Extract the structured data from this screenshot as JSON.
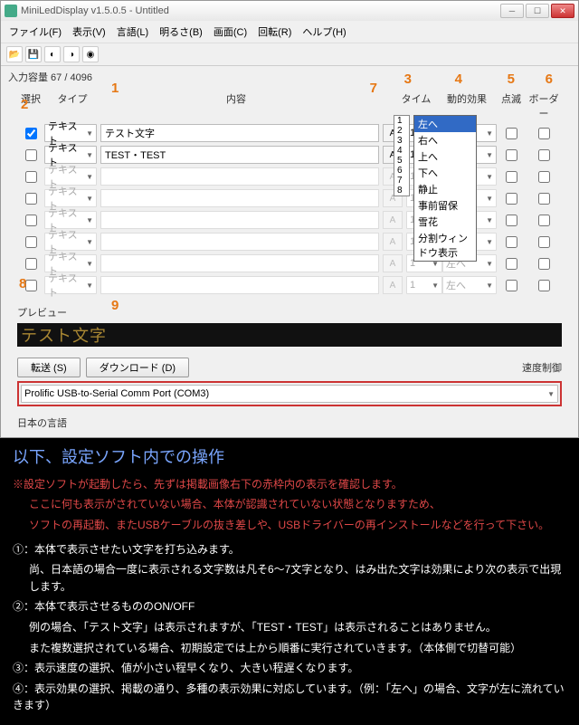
{
  "window": {
    "title": "MiniLedDisplay v1.5.0.5 - Untitled"
  },
  "menu": [
    "ファイル(F)",
    "表示(V)",
    "言語(L)",
    "明るさ(B)",
    "画面(C)",
    "回転(R)",
    "ヘルプ(H)"
  ],
  "capacity": "入力容量 67 / 4096",
  "hdr": {
    "sel": "選択",
    "type": "タイプ",
    "content": "内容",
    "time": "タイム",
    "eff": "動的効果",
    "flash": "点滅",
    "border": "ボーダー"
  },
  "type_label": "テキスト",
  "rows": [
    {
      "checked": true,
      "content": "テスト文字",
      "a": "A",
      "time": "1",
      "eff": "左へ"
    },
    {
      "checked": false,
      "content": "TEST・TEST",
      "a": "A",
      "time": "1",
      "eff": "左へ"
    },
    {
      "checked": false,
      "content": "",
      "a": "A",
      "time": "1",
      "eff": "左へ"
    },
    {
      "checked": false,
      "content": "",
      "a": "A",
      "time": "1",
      "eff": "左へ"
    },
    {
      "checked": false,
      "content": "",
      "a": "A",
      "time": "1",
      "eff": "左へ"
    },
    {
      "checked": false,
      "content": "",
      "a": "A",
      "time": "1",
      "eff": "左へ"
    },
    {
      "checked": false,
      "content": "",
      "a": "A",
      "time": "1",
      "eff": "左へ"
    },
    {
      "checked": false,
      "content": "",
      "a": "A",
      "time": "1",
      "eff": "左へ"
    }
  ],
  "time_opts": [
    "1",
    "2",
    "3",
    "4",
    "5",
    "6",
    "7",
    "8"
  ],
  "eff_opts": [
    "左へ",
    "右へ",
    "上へ",
    "下へ",
    "静止",
    "事前留保",
    "雪花",
    "分割ウィンドウ表示"
  ],
  "preview_label": "プレビュー",
  "preview_text": "テスト文字",
  "btn_send": "転送 (S)",
  "btn_dl": "ダウンロード (D)",
  "speed_label": "速度制御",
  "port": "Prolific USB-to-Serial Comm Port (COM3)",
  "lang": "日本の言語",
  "annot": {
    "1": "1",
    "2": "2",
    "3": "3",
    "4": "4",
    "5": "5",
    "6": "6",
    "7": "7",
    "8": "8",
    "9": "9"
  },
  "tut": {
    "title": "以下、設定ソフト内での操作",
    "w1": "※設定ソフトが起動したら、先ずは掲載画像右下の赤枠内の表示を確認します。",
    "w2": "ここに何も表示がされていない場合、本体が認識されていない状態となりますため、",
    "w3": "ソフトの再起動、またUSBケーブルの抜き差しや、USBドライバーの再インストールなどを行って下さい。",
    "p1": "①：本体で表示させたい文字を打ち込みます。",
    "p1b": "尚、日本語の場合一度に表示される文字数は凡そ6～7文字となり、はみ出た文字は効果により次の表示で出現します。",
    "p2": "②：本体で表示させるもののON/OFF",
    "p2b": "例の場合、「テスト文字」は表示されますが、「TEST・TEST」は表示されることはありません。",
    "p2c": "また複数選択されている場合、初期設定では上から順番に実行されていきます。（本体側で切替可能）",
    "p3": "③：表示速度の選択、値が小さい程早くなり、大きい程遅くなります。",
    "p4": "④：表示効果の選択、掲載の通り、多種の表示効果に対応しています。（例：「左へ」の場合、文字が左に流れていきます）"
  }
}
